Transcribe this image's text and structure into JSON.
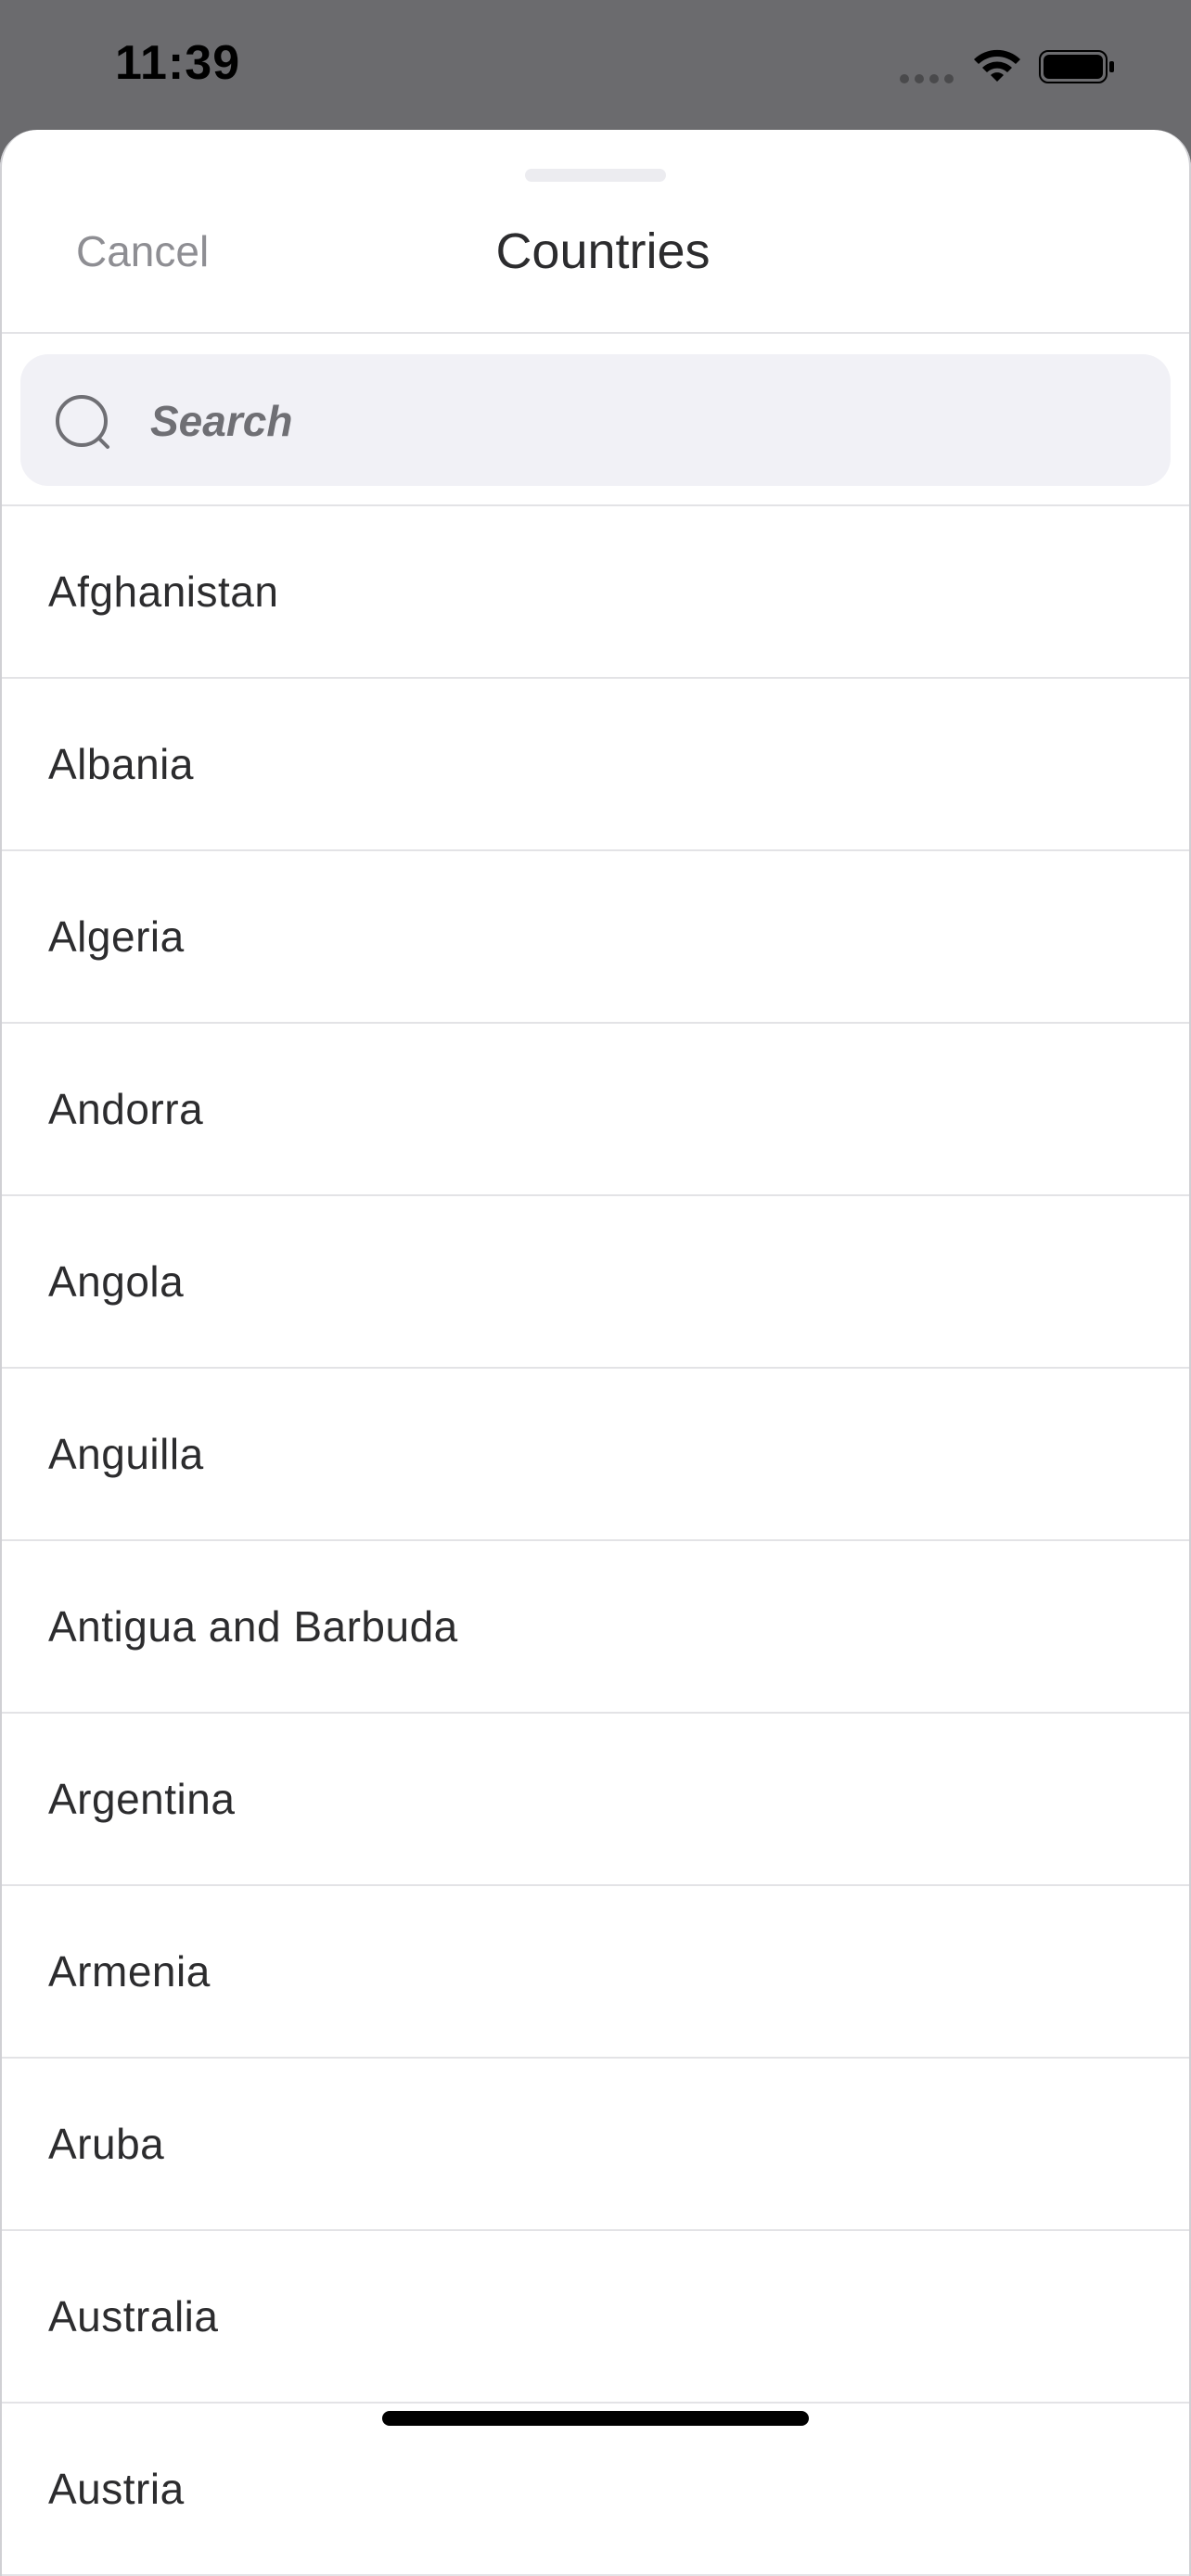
{
  "status_bar": {
    "time": "11:39"
  },
  "sheet": {
    "cancel_label": "Cancel",
    "title": "Countries"
  },
  "search": {
    "placeholder": "Search",
    "value": ""
  },
  "countries": [
    "Afghanistan",
    "Albania",
    "Algeria",
    "Andorra",
    "Angola",
    "Anguilla",
    "Antigua and Barbuda",
    "Argentina",
    "Armenia",
    "Aruba",
    "Australia",
    "Austria"
  ],
  "colors": {
    "backdrop": "#6b6b6e",
    "sheet_background": "#ffffff",
    "search_background": "#f1f1f6",
    "separator": "#e3e3e6",
    "cancel_text": "#8e8e93",
    "primary_text": "#2c2c2e"
  }
}
